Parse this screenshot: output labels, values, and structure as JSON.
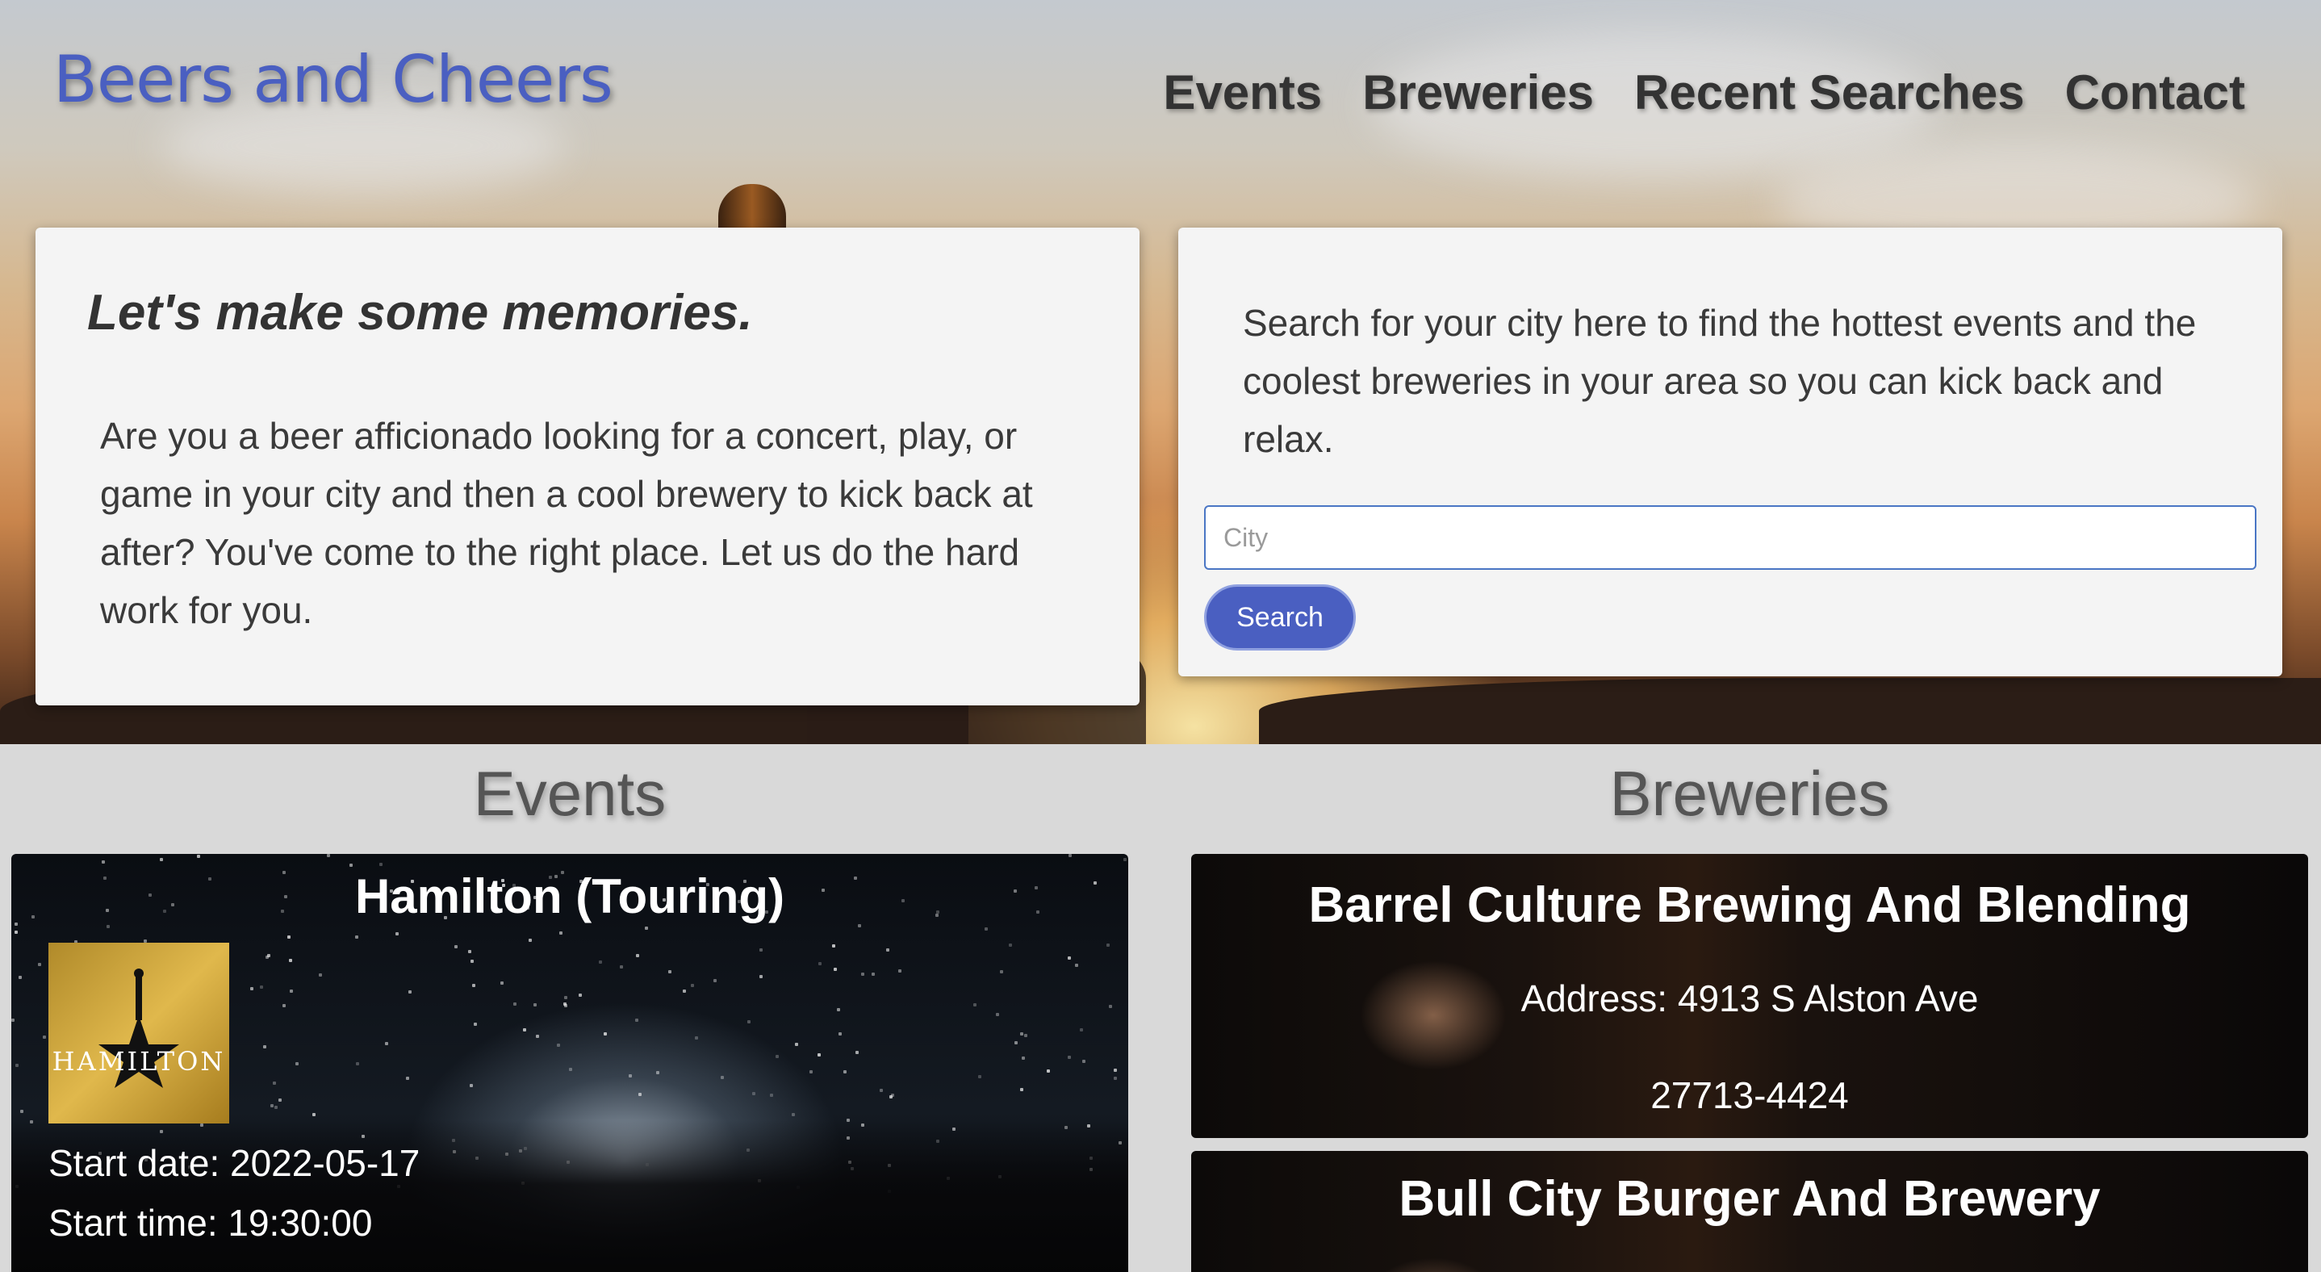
{
  "header": {
    "brand": "Beers and Cheers",
    "nav": [
      "Events",
      "Breweries",
      "Recent Searches",
      "Contact"
    ]
  },
  "intro": {
    "tagline": "Let's make some memories.",
    "body": "Are you a beer afficionado looking for a concert, play, or game in your city and then a cool brewery to kick back at after? You've come to the right place. Let us do the hard work for you."
  },
  "search": {
    "description": "Search for your city here to find the hottest events and the coolest breweries in your area so you can kick back and relax.",
    "placeholder": "City",
    "value": "",
    "button_label": "Search"
  },
  "events": {
    "heading": "Events",
    "items": [
      {
        "name": "Hamilton (Touring)",
        "logo_text": "HAMILTON",
        "start_date": "Start date: 2022-05-17",
        "start_time": "Start time: 19:30:00"
      }
    ]
  },
  "breweries": {
    "heading": "Breweries",
    "items": [
      {
        "name": "Barrel Culture Brewing And Blending",
        "address": "Address: 4913 S Alston Ave",
        "postal": "27713-4424"
      },
      {
        "name": "Bull City Burger And Brewery"
      }
    ]
  },
  "colors": {
    "brand": "#4a5fc1",
    "button": "#4a5fc1",
    "card_bg": "#f4f4f4",
    "page_bg": "#d9d9d9"
  }
}
